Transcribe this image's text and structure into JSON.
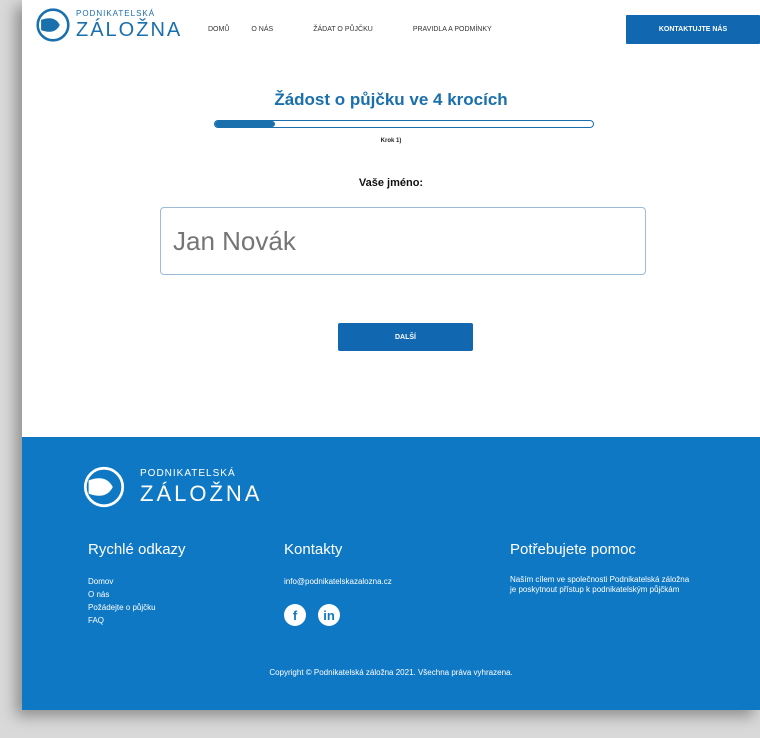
{
  "header": {
    "logo": {
      "small": "PODNIKATELSKÁ",
      "big": "ZÁLOŽNA"
    },
    "nav": [
      "DOMŮ",
      "O NÁS",
      "ŽÁDAT O PŮJČKU",
      "PRAVIDLA A PODMÍNKY"
    ],
    "cta_label": "KONTAKTUJTE NÁS"
  },
  "form": {
    "title": "Žádost  o půjčku ve 4 krocích",
    "progress_fraction": 0.16,
    "step_label": "Krok 1)",
    "field_label": "Vaše jméno:",
    "name_placeholder": "Jan Novák",
    "next_label": "DALŠÍ"
  },
  "footer": {
    "logo": {
      "small": "PODNIKATELSKÁ",
      "big": "ZÁLOŽNA"
    },
    "quick_links": {
      "heading": "Rychlé odkazy",
      "items": [
        "Domov",
        "O nás",
        "Požádejte o půjčku",
        "FAQ"
      ]
    },
    "contacts": {
      "heading": "Kontakty",
      "email": "info@podnikatelskazalozna.cz",
      "social": [
        "facebook-icon",
        "linkedin-icon"
      ]
    },
    "help": {
      "heading": "Potřebujete pomoc",
      "line1": "Naším cílem ve společnosti Podnikatelská záložna",
      "line2": "je poskytnout přístup k podnikatelským půjčkám"
    },
    "copyright": "Copyright © Podnikatelská záložna 2021. Všechna práva vyhrazena."
  },
  "colors": {
    "brand": "#1268b0",
    "footer_bg": "#0e78c4",
    "white": "#ffffff"
  }
}
